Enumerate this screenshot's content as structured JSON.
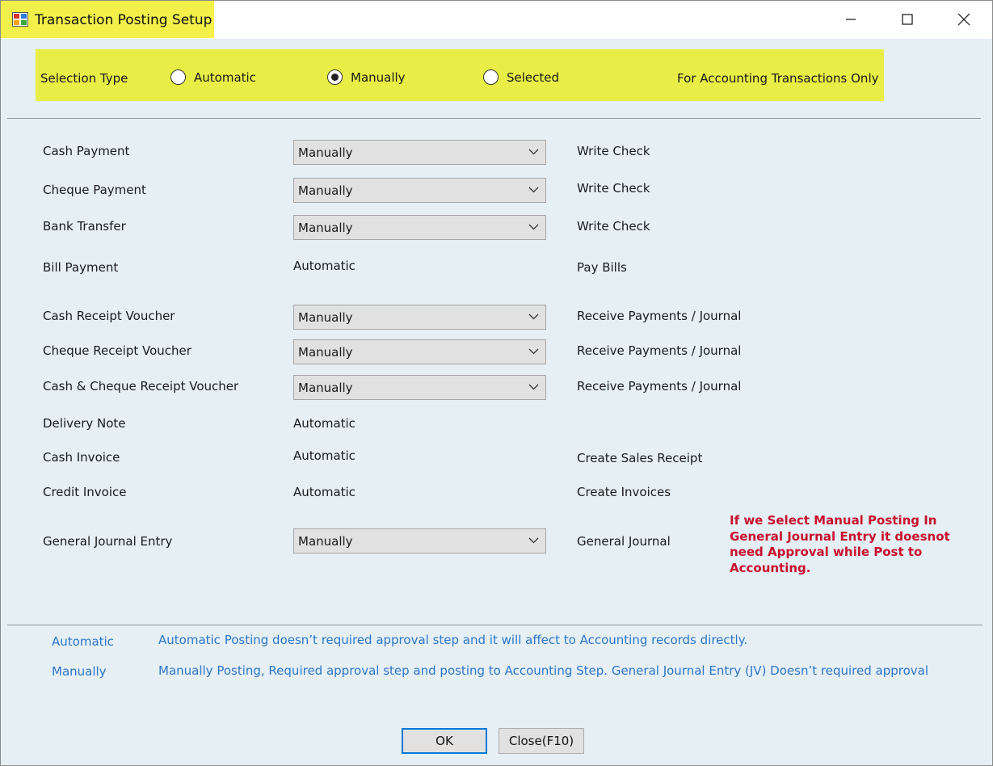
{
  "window": {
    "title": "Transaction Posting Setup",
    "highlight_color": "#f3f04a",
    "icons": [
      "app-icon",
      "minimize-icon",
      "maximize-icon",
      "close-icon"
    ]
  },
  "selection": {
    "label": "Selection Type",
    "options": [
      {
        "label": "Automatic",
        "selected": false
      },
      {
        "label": "Manually",
        "selected": true
      },
      {
        "label": "Selected",
        "selected": false
      }
    ],
    "note": "For Accounting Transactions Only"
  },
  "rows": [
    {
      "label": "Cash Payment",
      "kind": "combo",
      "value": "Manually",
      "target": "Write Check"
    },
    {
      "label": "Cheque Payment",
      "kind": "combo",
      "value": "Manually",
      "target": "Write Check"
    },
    {
      "label": "Bank Transfer",
      "kind": "combo",
      "value": "Manually",
      "target": "Write Check"
    },
    {
      "label": "Bill Payment",
      "kind": "text",
      "value": "Automatic",
      "target": "Pay Bills"
    },
    {
      "label": "Cash Receipt Voucher",
      "kind": "combo",
      "value": "Manually",
      "target": "Receive Payments / Journal"
    },
    {
      "label": "Cheque Receipt Voucher",
      "kind": "combo",
      "value": "Manually",
      "target": "Receive Payments / Journal"
    },
    {
      "label": "Cash & Cheque Receipt Voucher",
      "kind": "combo",
      "value": "Manually",
      "target": "Receive Payments / Journal"
    },
    {
      "label": "Delivery Note",
      "kind": "text",
      "value": "Automatic",
      "target": ""
    },
    {
      "label": "Cash Invoice",
      "kind": "text",
      "value": "Automatic",
      "target": "Create Sales Receipt"
    },
    {
      "label": "Credit Invoice",
      "kind": "text",
      "value": "Automatic",
      "target": "Create Invoices"
    },
    {
      "label": "General Journal Entry",
      "kind": "combo",
      "value": "Manually",
      "target": "General Journal"
    }
  ],
  "note_lines": [
    "If we Select Manual Posting In",
    "General Journal Entry  it doesnot",
    "need Approval while Post to",
    "Accounting."
  ],
  "note_color": "#c8102e",
  "legend": [
    {
      "key": "Automatic",
      "desc": "Automatic Posting doesn’t required approval step and it will affect to Accounting records directly."
    },
    {
      "key": "Manually",
      "desc": "Manually Posting, Required approval step and posting to Accounting Step. General Journal Entry (JV) Doesn’t required approval"
    }
  ],
  "legend_color": "#2f76c8",
  "buttons": {
    "ok": "OK",
    "close": "Close(F10)"
  }
}
